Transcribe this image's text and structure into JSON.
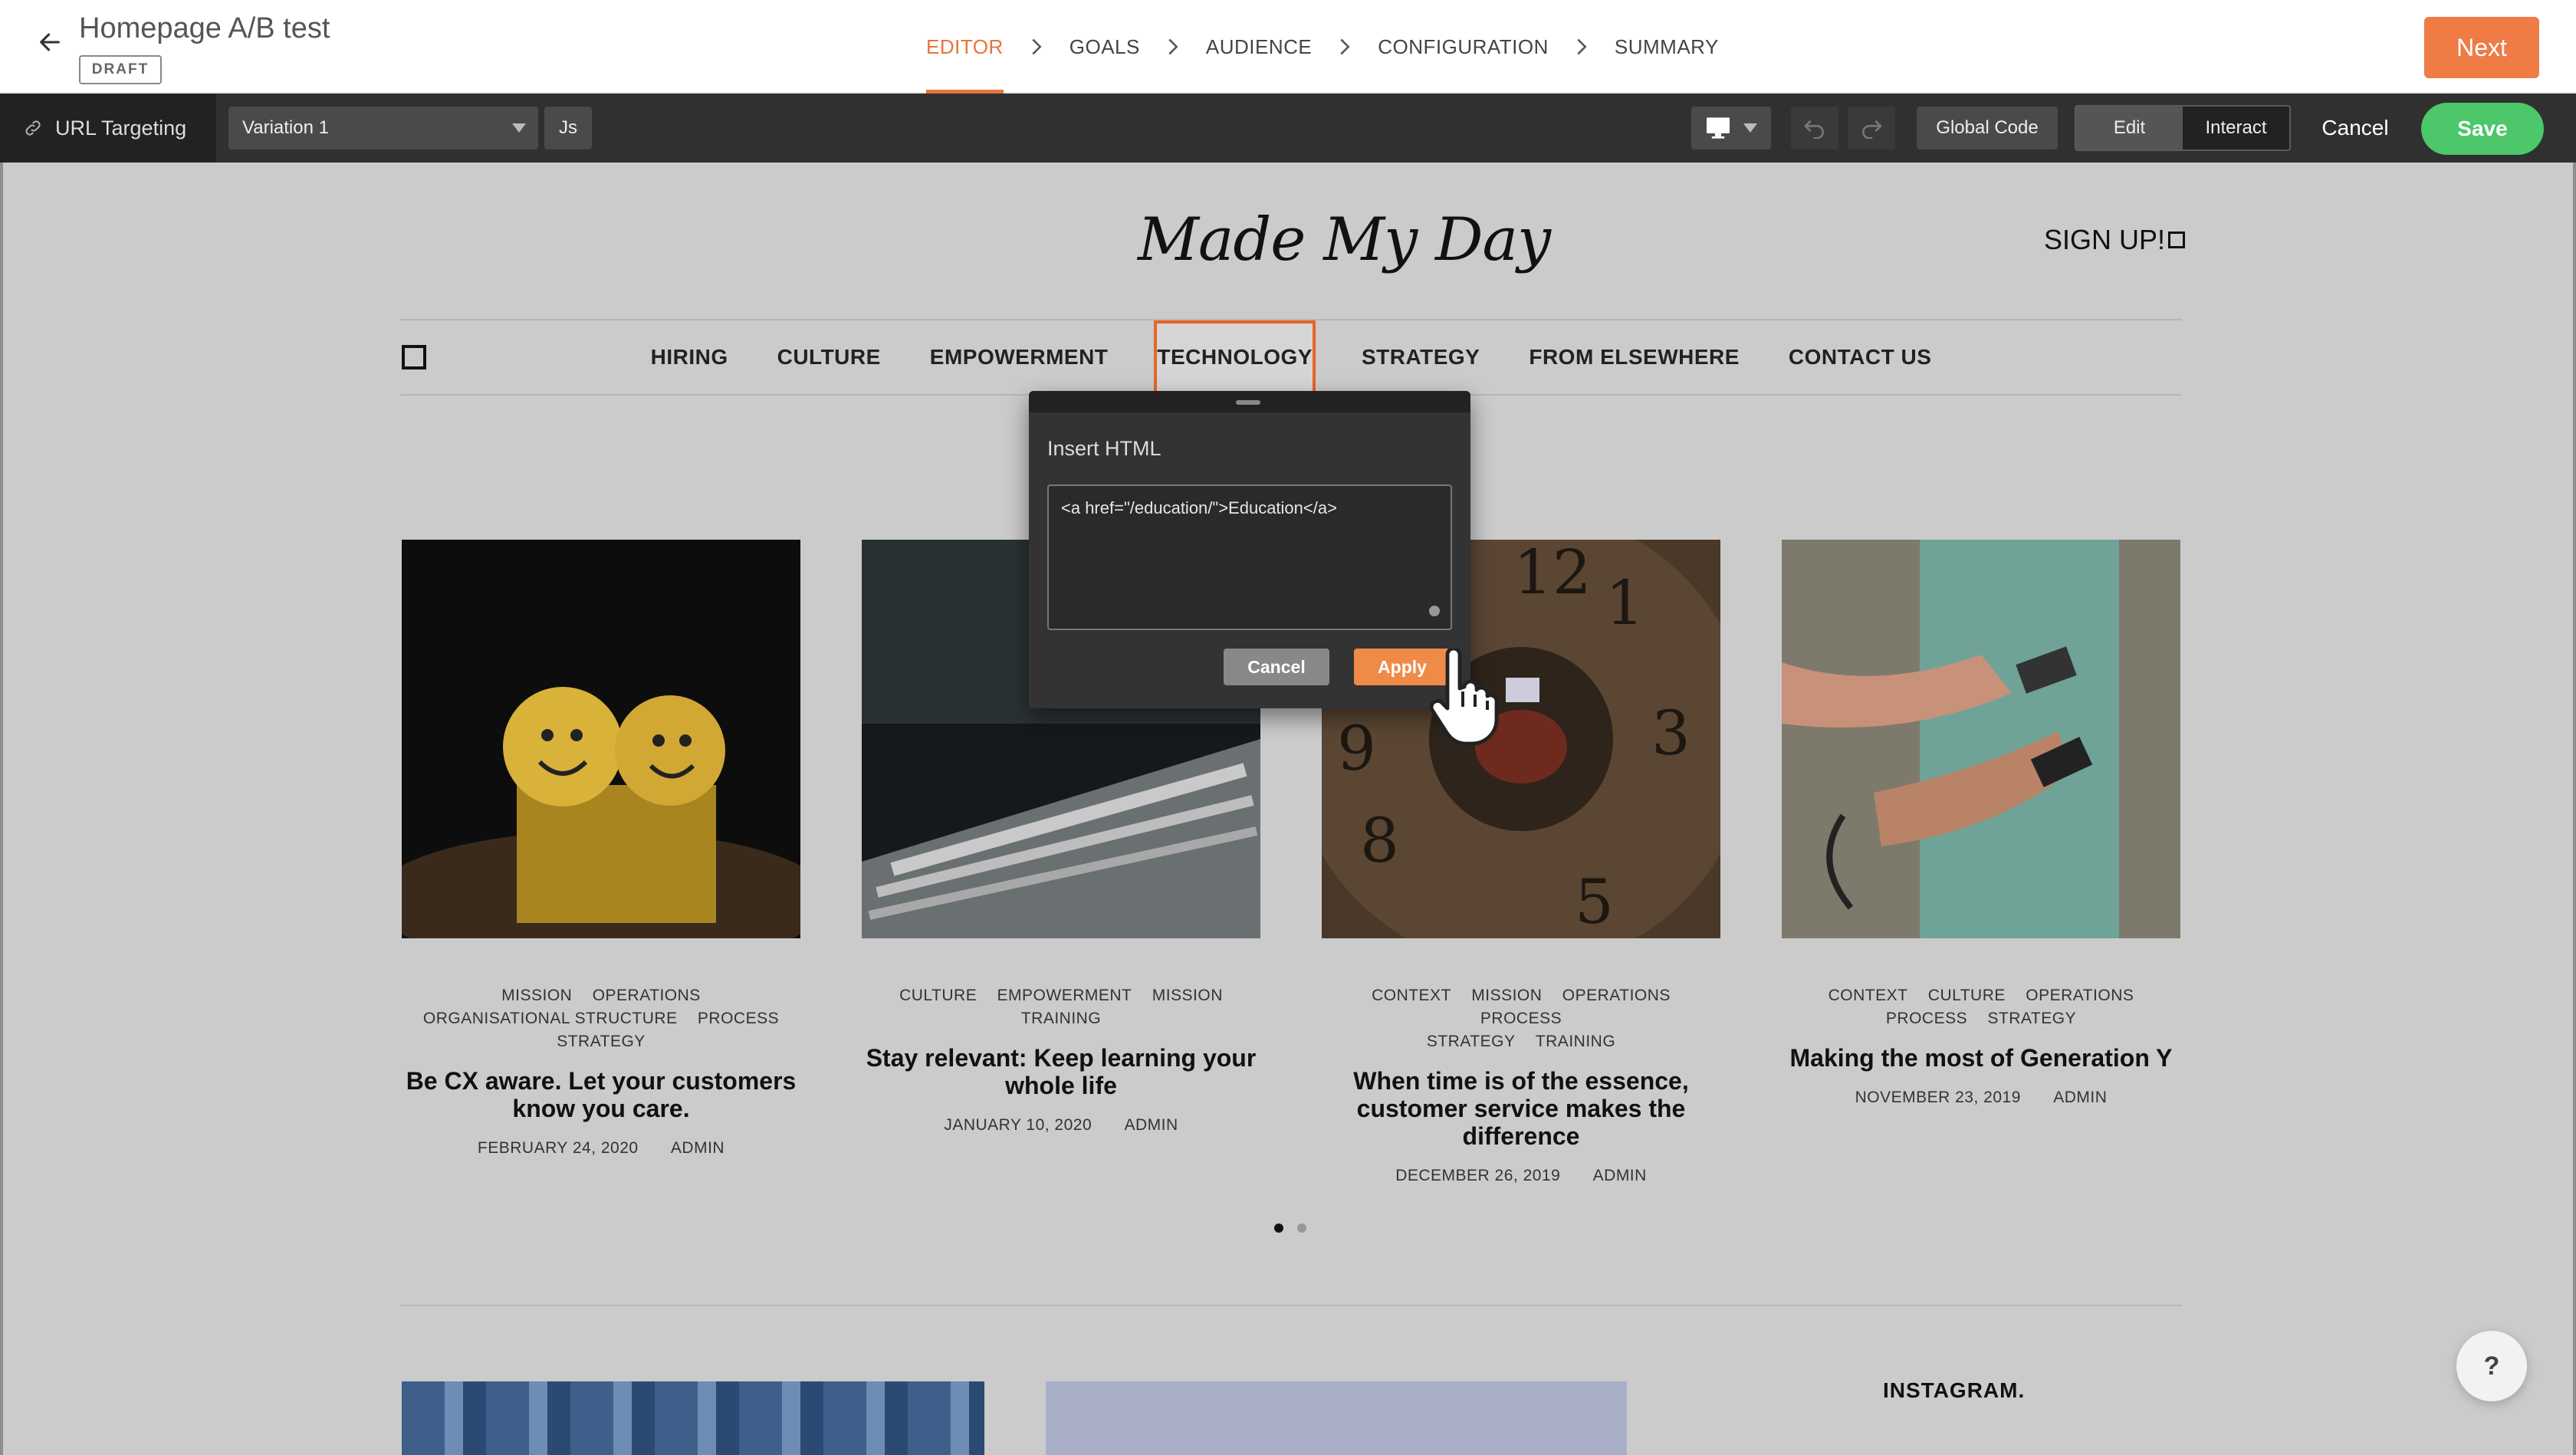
{
  "header": {
    "title": "Homepage A/B test",
    "status": "DRAFT",
    "steps": [
      "EDITOR",
      "GOALS",
      "AUDIENCE",
      "CONFIGURATION",
      "SUMMARY"
    ],
    "active_step": "EDITOR",
    "next_label": "Next"
  },
  "toolbar": {
    "url_targeting": "URL Targeting",
    "variation": "Variation 1",
    "js_label": "Js",
    "global_code": "Global Code",
    "edit_label": "Edit",
    "interact_label": "Interact",
    "cancel_label": "Cancel",
    "save_label": "Save"
  },
  "site": {
    "logo": "Made My Day",
    "signup": "SIGN UP!",
    "nav": [
      "HIRING",
      "CULTURE",
      "EMPOWERMENT",
      "TECHNOLOGY",
      "STRATEGY",
      "FROM ELSEWHERE",
      "CONTACT US"
    ],
    "selected_nav": "TECHNOLOGY",
    "posts": [
      {
        "tags": [
          "MISSION",
          "OPERATIONS",
          "ORGANISATIONAL STRUCTURE",
          "PROCESS",
          "STRATEGY"
        ],
        "title": "Be CX aware. Let your customers know you care.",
        "date": "FEBRUARY 24, 2020",
        "author": "ADMIN"
      },
      {
        "tags": [
          "CULTURE",
          "EMPOWERMENT",
          "MISSION",
          "TRAINING"
        ],
        "title": "Stay relevant: Keep learning your whole life",
        "date": "JANUARY 10, 2020",
        "author": "ADMIN"
      },
      {
        "tags": [
          "CONTEXT",
          "MISSION",
          "OPERATIONS",
          "PROCESS",
          "STRATEGY",
          "TRAINING"
        ],
        "title": "When time is of the essence, customer service makes the difference",
        "date": "DECEMBER 26, 2019",
        "author": "ADMIN"
      },
      {
        "tags": [
          "CONTEXT",
          "CULTURE",
          "OPERATIONS",
          "PROCESS",
          "STRATEGY"
        ],
        "title": "Making the most of Generation Y",
        "date": "NOVEMBER 23, 2019",
        "author": "ADMIN"
      }
    ],
    "carousel_pages": 2,
    "carousel_active": 1,
    "instagram": "INSTAGRAM.",
    "help": "?"
  },
  "dialog": {
    "title": "Insert HTML",
    "value": "<a href=\"/education/\">Education</a>",
    "cancel_label": "Cancel",
    "apply_label": "Apply"
  },
  "colors": {
    "accent": "#e8743b",
    "save_green": "#4cc76a",
    "selection_outline": "#e8632b"
  }
}
